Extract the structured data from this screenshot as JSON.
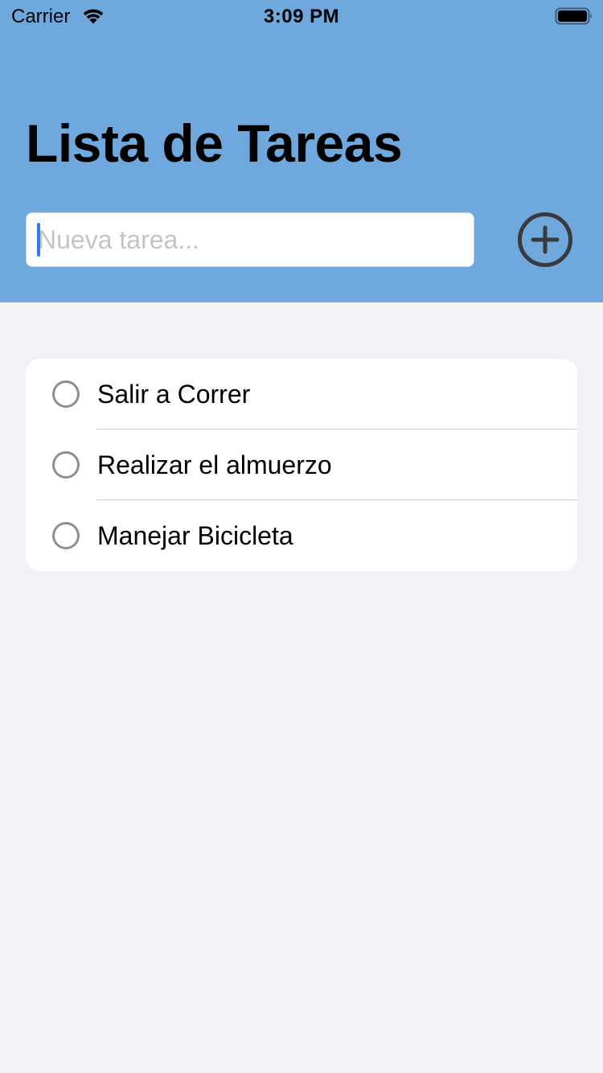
{
  "status_bar": {
    "carrier": "Carrier",
    "time": "3:09 PM",
    "icons": [
      "wifi-icon",
      "battery-icon"
    ]
  },
  "header": {
    "title": "Lista de Tareas",
    "background_color": "#6fa8dd"
  },
  "new_task": {
    "value": "",
    "placeholder": "Nueva tarea...",
    "add_button_icon": "plus-circle-icon"
  },
  "tasks": [
    {
      "label": "Salir a Correr",
      "completed": false,
      "icon": "check-circle-icon"
    },
    {
      "label": "Realizar el almuerzo",
      "completed": false,
      "icon": "check-circle-icon"
    },
    {
      "label": "Manejar Bicicleta",
      "completed": false,
      "icon": "check-circle-icon"
    }
  ],
  "colors": {
    "page_background": "#f1f1f6",
    "card_background": "#ffffff",
    "cursor": "#2f7bf6",
    "circle_stroke": "#8e8e93"
  }
}
